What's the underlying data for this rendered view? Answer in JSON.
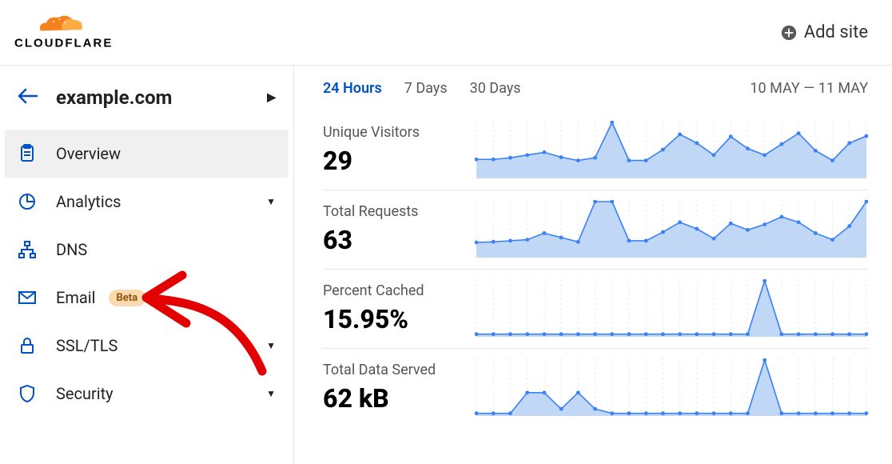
{
  "header": {
    "brand": "CLOUDFLARE",
    "add_site_label": "Add site"
  },
  "sidebar": {
    "site_name": "example.com",
    "items": [
      {
        "label": "Overview"
      },
      {
        "label": "Analytics"
      },
      {
        "label": "DNS"
      },
      {
        "label": "Email",
        "badge": "Beta"
      },
      {
        "label": "SSL/TLS"
      },
      {
        "label": "Security"
      }
    ]
  },
  "main": {
    "tabs": [
      {
        "label": "24 Hours"
      },
      {
        "label": "7 Days"
      },
      {
        "label": "30 Days"
      }
    ],
    "date_range": "10 MAY — 11 MAY",
    "stats": [
      {
        "label": "Unique Visitors",
        "value": "29"
      },
      {
        "label": "Total Requests",
        "value": "63"
      },
      {
        "label": "Percent Cached",
        "value": "15.95%"
      },
      {
        "label": "Total Data Served",
        "value": "62 kB"
      }
    ]
  },
  "chart_data": [
    {
      "type": "area",
      "title": "Unique Visitors",
      "ylim": [
        0,
        100
      ],
      "x": [
        0,
        1,
        2,
        3,
        4,
        5,
        6,
        7,
        8,
        9,
        10,
        11,
        12,
        13,
        14,
        15,
        16,
        17,
        18,
        19,
        20,
        21,
        22,
        23
      ],
      "values": [
        32,
        32,
        35,
        40,
        45,
        36,
        30,
        35,
        100,
        30,
        30,
        50,
        78,
        62,
        40,
        74,
        52,
        40,
        60,
        80,
        48,
        30,
        62,
        75
      ]
    },
    {
      "type": "area",
      "title": "Total Requests",
      "ylim": [
        0,
        100
      ],
      "x": [
        0,
        1,
        2,
        3,
        4,
        5,
        6,
        7,
        8,
        9,
        10,
        11,
        12,
        13,
        14,
        15,
        16,
        17,
        18,
        19,
        20,
        21,
        22,
        23
      ],
      "values": [
        25,
        26,
        28,
        30,
        42,
        34,
        26,
        100,
        100,
        28,
        28,
        44,
        62,
        50,
        32,
        60,
        48,
        58,
        72,
        62,
        42,
        30,
        55,
        100
      ]
    },
    {
      "type": "area",
      "title": "Percent Cached",
      "ylim": [
        0,
        100
      ],
      "x": [
        0,
        1,
        2,
        3,
        4,
        5,
        6,
        7,
        8,
        9,
        10,
        11,
        12,
        13,
        14,
        15,
        16,
        17,
        18,
        19,
        20,
        21,
        22,
        23
      ],
      "values": [
        2,
        2,
        2,
        2,
        2,
        2,
        2,
        2,
        2,
        2,
        2,
        2,
        2,
        2,
        2,
        2,
        2,
        100,
        2,
        2,
        2,
        2,
        2,
        2
      ]
    },
    {
      "type": "area",
      "title": "Total Data Served",
      "ylim": [
        0,
        100
      ],
      "x": [
        0,
        1,
        2,
        3,
        4,
        5,
        6,
        7,
        8,
        9,
        10,
        11,
        12,
        13,
        14,
        15,
        16,
        17,
        18,
        19,
        20,
        21,
        22,
        23
      ],
      "values": [
        2,
        2,
        2,
        40,
        40,
        10,
        40,
        10,
        2,
        2,
        2,
        2,
        2,
        2,
        2,
        2,
        2,
        100,
        2,
        2,
        2,
        2,
        2,
        2
      ]
    }
  ]
}
